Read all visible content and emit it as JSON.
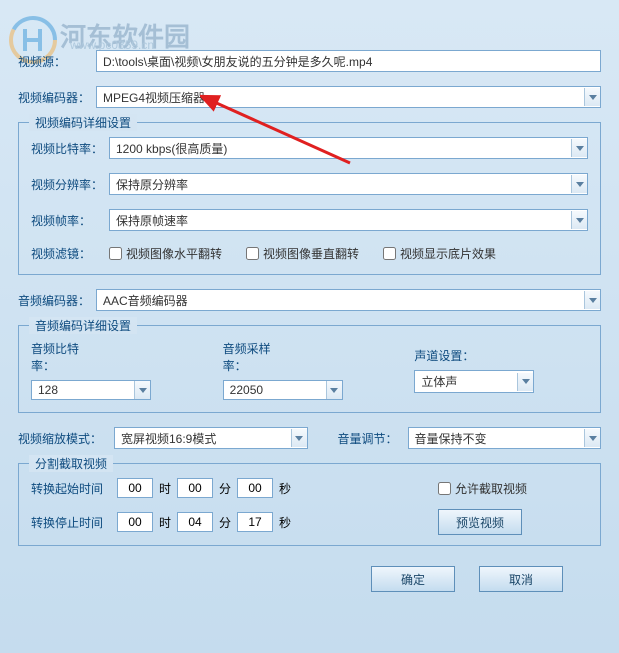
{
  "watermark": {
    "text": "河东软件园",
    "url": "www.pc0359.cn"
  },
  "source": {
    "label": "视频源：",
    "value": "D:\\tools\\桌面\\视频\\女朋友说的五分钟是多久呢.mp4"
  },
  "vencoder": {
    "label": "视频编码器：",
    "value": "MPEG4视频压缩器"
  },
  "venc_group": {
    "legend": "视频编码详细设置",
    "bitrate": {
      "label": "视频比特率：",
      "value": "1200 kbps(很高质量)"
    },
    "resolution": {
      "label": "视频分辨率：",
      "value": "保持原分辨率"
    },
    "fps": {
      "label": "视频帧率：",
      "value": "保持原帧速率"
    },
    "filter": {
      "label": "视频滤镜：",
      "hflip": "视频图像水平翻转",
      "vflip": "视频图像垂直翻转",
      "negative": "视频显示底片效果"
    }
  },
  "aencoder": {
    "label": "音频编码器：",
    "value": "AAC音频编码器"
  },
  "aenc_group": {
    "legend": "音频编码详细设置",
    "bitrate": {
      "label": "音频比特率：",
      "value": "128"
    },
    "samplerate": {
      "label": "音频采样率：",
      "value": "22050"
    },
    "channel": {
      "label": "声道设置：",
      "value": "立体声"
    }
  },
  "misc": {
    "scale": {
      "label": "视频缩放模式：",
      "value": "宽屏视频16:9模式"
    },
    "volume": {
      "label": "音量调节：",
      "value": "音量保持不变"
    }
  },
  "trim": {
    "legend": "分割截取视频",
    "start": {
      "label": "转换起始时间",
      "h": "00",
      "m": "00",
      "s": "00"
    },
    "end": {
      "label": "转换停止时间",
      "h": "00",
      "m": "04",
      "s": "17"
    },
    "hour_unit": "时",
    "min_unit": "分",
    "sec_unit": "秒",
    "allow": "允许截取视频",
    "preview": "预览视频"
  },
  "actions": {
    "ok": "确定",
    "cancel": "取消"
  }
}
